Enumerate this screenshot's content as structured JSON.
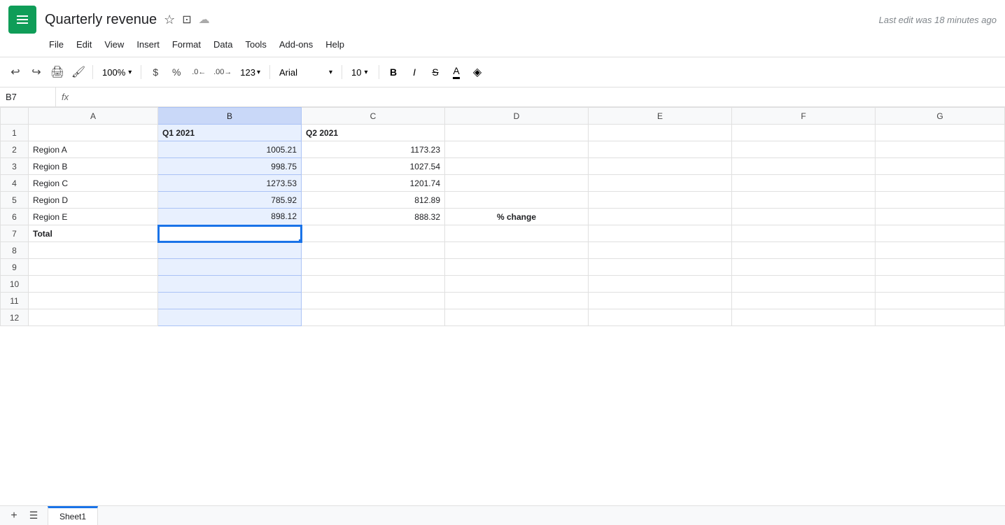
{
  "app": {
    "logo_alt": "Google Sheets logo",
    "title": "Quarterly revenue",
    "last_edit": "Last edit was 18 minutes ago"
  },
  "title_icons": {
    "star": "☆",
    "folder": "⊡",
    "cloud": "☁"
  },
  "menu": {
    "items": [
      "File",
      "Edit",
      "View",
      "Insert",
      "Format",
      "Data",
      "Tools",
      "Add-ons",
      "Help"
    ]
  },
  "toolbar": {
    "undo": "↩",
    "redo": "↪",
    "print": "🖨",
    "paint": "🖌",
    "zoom": "100%",
    "zoom_arrow": "▾",
    "dollar": "$",
    "percent": "%",
    "decimal_less": ".0",
    "decimal_more": ".00",
    "more_formats": "123▾",
    "font_name": "Arial",
    "font_arrow": "▾",
    "font_size": "10",
    "size_arrow": "▾",
    "bold": "B",
    "italic": "I",
    "strikethrough": "S",
    "text_color": "A",
    "fill_color": "◈"
  },
  "formula_bar": {
    "cell_ref": "B7",
    "formula": ""
  },
  "columns": {
    "headers": [
      "",
      "A",
      "B",
      "C",
      "D",
      "E",
      "F",
      "G"
    ]
  },
  "rows": [
    {
      "row_num": "1",
      "cells": [
        "",
        "Q1 2021",
        "Q2 2021",
        "",
        "",
        "",
        ""
      ]
    },
    {
      "row_num": "2",
      "cells": [
        "Region A",
        "1005.21",
        "1173.23",
        "",
        "",
        "",
        ""
      ]
    },
    {
      "row_num": "3",
      "cells": [
        "Region B",
        "998.75",
        "1027.54",
        "",
        "",
        "",
        ""
      ]
    },
    {
      "row_num": "4",
      "cells": [
        "Region C",
        "1273.53",
        "1201.74",
        "",
        "",
        "",
        ""
      ]
    },
    {
      "row_num": "5",
      "cells": [
        "Region D",
        "785.92",
        "812.89",
        "",
        "",
        "",
        ""
      ]
    },
    {
      "row_num": "6",
      "cells": [
        "Region E",
        "898.12",
        "888.32",
        "% change",
        "",
        "",
        ""
      ]
    },
    {
      "row_num": "7",
      "cells": [
        "Total",
        "",
        "",
        "",
        "",
        "",
        ""
      ]
    },
    {
      "row_num": "8",
      "cells": [
        "",
        "",
        "",
        "",
        "",
        "",
        ""
      ]
    },
    {
      "row_num": "9",
      "cells": [
        "",
        "",
        "",
        "",
        "",
        "",
        ""
      ]
    },
    {
      "row_num": "10",
      "cells": [
        "",
        "",
        "",
        "",
        "",
        "",
        ""
      ]
    },
    {
      "row_num": "11",
      "cells": [
        "",
        "",
        "",
        "",
        "",
        "",
        ""
      ]
    },
    {
      "row_num": "12",
      "cells": [
        "",
        "",
        "",
        "",
        "",
        "",
        ""
      ]
    }
  ],
  "cell_styles": {
    "bold_cells": [
      "B1",
      "C1",
      "A7",
      "D6"
    ],
    "active_cell": "B7",
    "selected_col": "B"
  },
  "bottom": {
    "sheet_tab": "Sheet1"
  },
  "colors": {
    "google_green": "#0f9d58",
    "selected_col_header": "#c9d8f8",
    "selected_col_cell": "#e8f0fe",
    "active_cell_border": "#1a73e8",
    "active_cell_handle": "#1a73e8"
  }
}
